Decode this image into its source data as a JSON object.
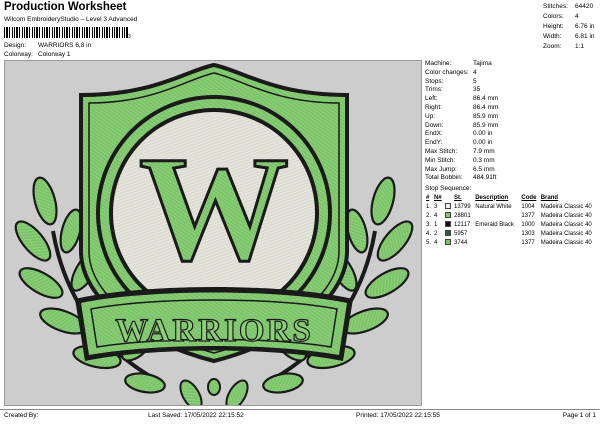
{
  "header": {
    "title": "Production Worksheet",
    "subtitle": "Wilcom EmbroideryStudio – Level 3 Advanced",
    "barcode_digit": "3",
    "design_label": "Design:",
    "design_value": "WARRIORS 6,8 in",
    "colorway_label": "Colorway:",
    "colorway_value": "Colorway 1"
  },
  "summary": [
    {
      "label": "Stitches:",
      "value": "64420"
    },
    {
      "label": "Colors:",
      "value": "4"
    },
    {
      "label": "Height:",
      "value": "6.76 in"
    },
    {
      "label": "Width:",
      "value": "6.81 in"
    },
    {
      "label": "Zoom:",
      "value": "1:1"
    }
  ],
  "design": {
    "text_letter": "W",
    "banner_text": "WARRIORS",
    "colors": {
      "background": "#cdcdcd",
      "green": "#7cc46a",
      "light_green": "#95d280",
      "black": "#1a1a1a",
      "white": "#e0e0d8"
    }
  },
  "machine_info": [
    {
      "label": "Machine:",
      "value": "Tajima"
    },
    {
      "label": "Color changes:",
      "value": "4"
    },
    {
      "label": "Stops:",
      "value": "5"
    },
    {
      "label": "Trims:",
      "value": "35"
    },
    {
      "label": "Left:",
      "value": "86.4 mm"
    },
    {
      "label": "Right:",
      "value": "86.4 mm"
    },
    {
      "label": "Up:",
      "value": "85.9 mm"
    },
    {
      "label": "Down:",
      "value": "85.9 mm"
    },
    {
      "label": "EndX:",
      "value": "0.00 in"
    },
    {
      "label": "EndY:",
      "value": "0.00 in"
    },
    {
      "label": "Max Stitch:",
      "value": "7.9 mm"
    },
    {
      "label": "Min Stitch:",
      "value": "0.3 mm"
    },
    {
      "label": "Max Jump:",
      "value": "6.5 mm"
    },
    {
      "label": "Total Bobbin:",
      "value": "484.91ft"
    }
  ],
  "stop_sequence": {
    "title": "Stop Sequence:",
    "headers": [
      "#",
      "N#",
      "St.",
      "Description",
      "Code",
      "Brand"
    ],
    "rows": [
      {
        "num": "1.",
        "n": "3",
        "color": "#eeeeee",
        "st": "13799",
        "desc": "Natural White",
        "code": "1004",
        "brand": "Madeira Classic 40"
      },
      {
        "num": "2.",
        "n": "4",
        "color": "#7cc46a",
        "st": "28801",
        "desc": "",
        "code": "1377",
        "brand": "Madeira Classic 40"
      },
      {
        "num": "3.",
        "n": "1",
        "color": "#111111",
        "st": "12117",
        "desc": "Emerald Black",
        "code": "1000",
        "brand": "Madeira Classic 40"
      },
      {
        "num": "4.",
        "n": "2",
        "color": "#2c5a34",
        "st": "5957",
        "desc": "",
        "code": "1303",
        "brand": "Madeira Classic 40"
      },
      {
        "num": "5.",
        "n": "4",
        "color": "#7cc46a",
        "st": "3744",
        "desc": "",
        "code": "1377",
        "brand": "Madeira Classic 40"
      }
    ]
  },
  "footer": {
    "created_by": "Created By:",
    "last_saved": "Last Saved: 17/05/2022 22:15:52",
    "printed": "Printed: 17/05/2022 22:15:55",
    "page": "Page 1 of 1"
  }
}
